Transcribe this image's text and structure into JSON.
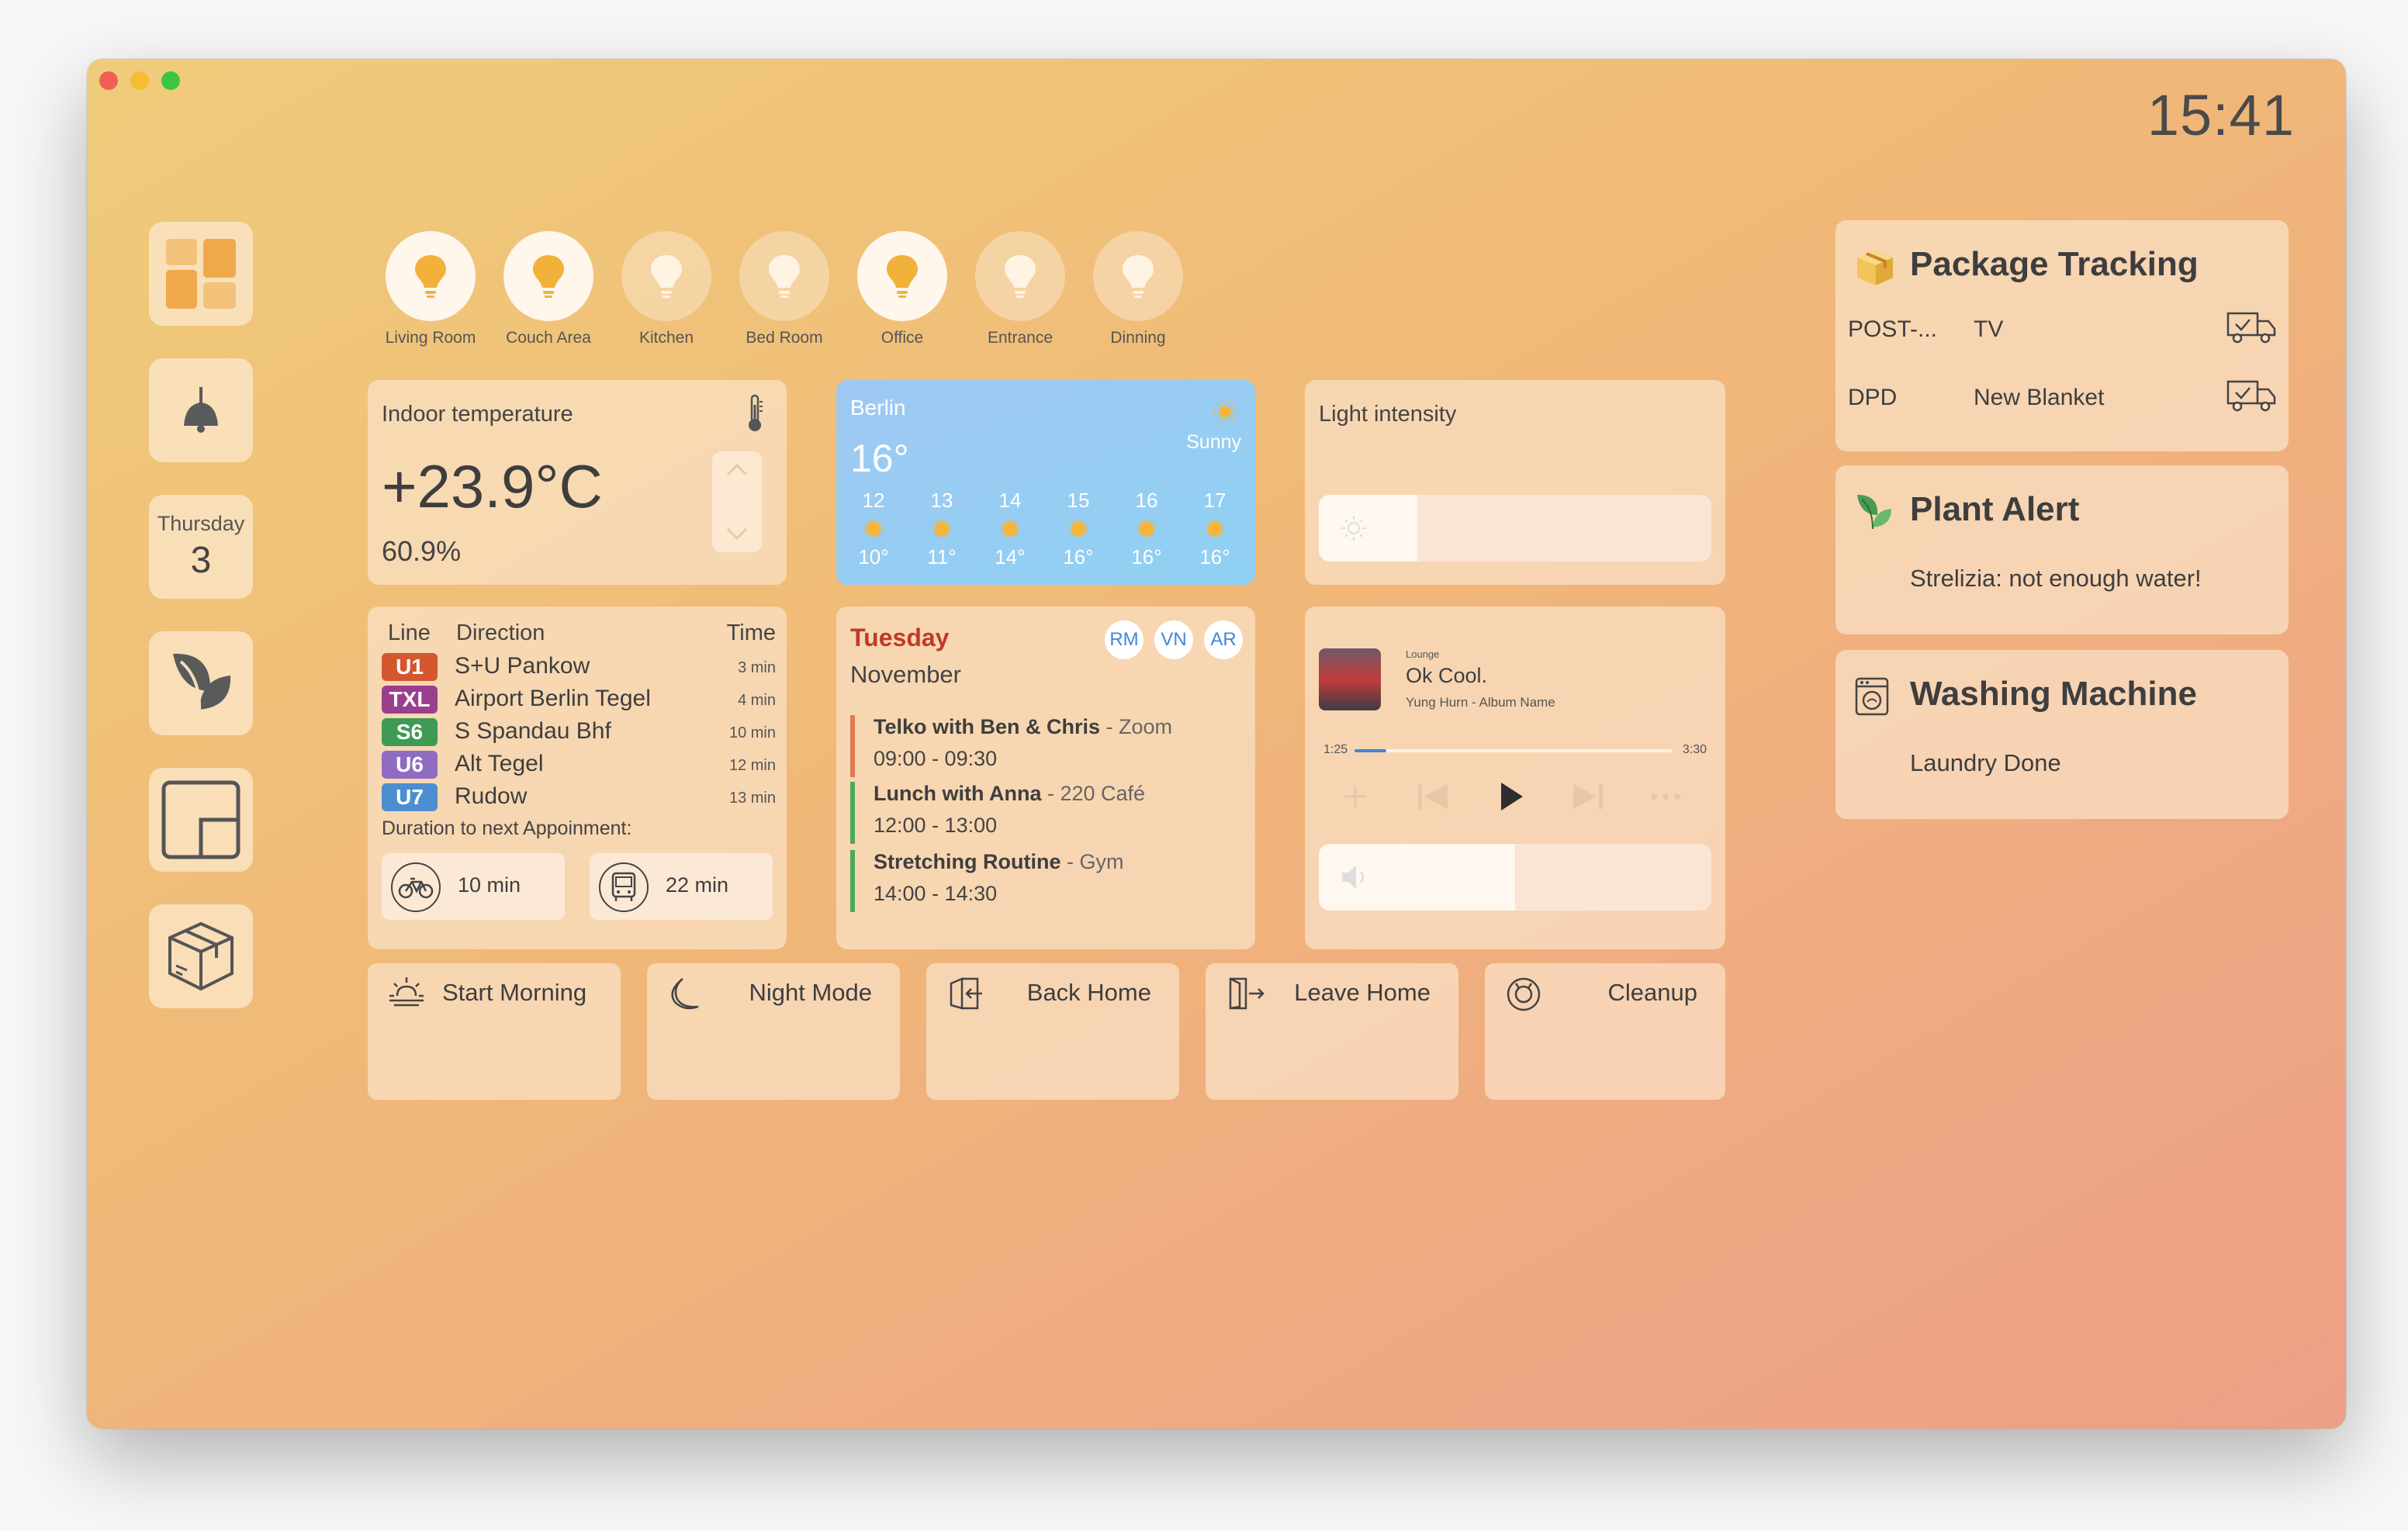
{
  "clock": "15:41",
  "sidebar": {
    "date_day": "Thursday",
    "date_num": "3"
  },
  "rooms": [
    {
      "label": "Living Room",
      "on": true
    },
    {
      "label": "Couch Area",
      "on": true
    },
    {
      "label": "Kitchen",
      "on": false
    },
    {
      "label": "Bed Room",
      "on": false
    },
    {
      "label": "Office",
      "on": true
    },
    {
      "label": "Entrance",
      "on": false
    },
    {
      "label": "Dinning",
      "on": false
    }
  ],
  "indoor": {
    "title": "Indoor temperature",
    "temperature": "+23.9°C",
    "humidity": "60.9%"
  },
  "weather": {
    "city": "Berlin",
    "temp": "16°",
    "condition": "Sunny",
    "hours": [
      {
        "hour": "12",
        "temp": "10°"
      },
      {
        "hour": "13",
        "temp": "11°"
      },
      {
        "hour": "14",
        "temp": "14°"
      },
      {
        "hour": "15",
        "temp": "16°"
      },
      {
        "hour": "16",
        "temp": "16°"
      },
      {
        "hour": "17",
        "temp": "16°"
      }
    ]
  },
  "light": {
    "title": "Light intensity",
    "level": 0.25
  },
  "transit": {
    "headers": {
      "line": "Line",
      "direction": "Direction",
      "time": "Time"
    },
    "rows": [
      {
        "line": "U1",
        "color": "#d4572f",
        "direction": "S+U Pankow",
        "time": "3 min"
      },
      {
        "line": "TXL",
        "color": "#9a3e8e",
        "direction": "Airport Berlin Tegel",
        "time": "4 min"
      },
      {
        "line": "S6",
        "color": "#3f9a54",
        "direction": "S Spandau Bhf",
        "time": "10 min"
      },
      {
        "line": "U6",
        "color": "#8f6cc2",
        "direction": "Alt Tegel",
        "time": "12 min"
      },
      {
        "line": "U7",
        "color": "#4c8ed0",
        "direction": "Rudow",
        "time": "13 min"
      }
    ],
    "duration_label": "Duration to next Appoinment:",
    "bike": "10 min",
    "bus": "22 min"
  },
  "calendar": {
    "day": "Tuesday",
    "month": "November",
    "avatars": [
      "RM",
      "VN",
      "AR"
    ],
    "events": [
      {
        "title": "Telko with Ben & Chris",
        "location": " - Zoom",
        "time": "09:00 - 09:30",
        "color": "#e07a55"
      },
      {
        "title": "Lunch with Anna",
        "location": " - 220 Café",
        "time": "12:00 - 13:00",
        "color": "#4aaa5a"
      },
      {
        "title": "Stretching Routine",
        "location": " - Gym",
        "time": "14:00 - 14:30",
        "color": "#4aaa5a"
      }
    ]
  },
  "music": {
    "category": "Lounge",
    "song": "Ok Cool.",
    "artist": "Yung Hurn - Album Name",
    "position": "1:25",
    "length": "3:30",
    "progress": 0.1,
    "volume": 0.5
  },
  "packages": {
    "title": "Package Tracking",
    "rows": [
      {
        "carrier": "POST-...",
        "item": "TV"
      },
      {
        "carrier": "DPD",
        "item": "New Blanket"
      }
    ]
  },
  "plant": {
    "title": "Plant Alert",
    "message": "Strelizia: not enough water!"
  },
  "washing": {
    "title": "Washing Machine",
    "message": "Laundry Done"
  },
  "scenes": [
    {
      "label": "Start Morning",
      "icon": "sunrise-icon"
    },
    {
      "label": "Night Mode",
      "icon": "moon-icon"
    },
    {
      "label": "Back Home",
      "icon": "door-enter-icon"
    },
    {
      "label": "Leave Home",
      "icon": "door-exit-icon"
    },
    {
      "label": "Cleanup",
      "icon": "robot-vacuum-icon"
    }
  ]
}
